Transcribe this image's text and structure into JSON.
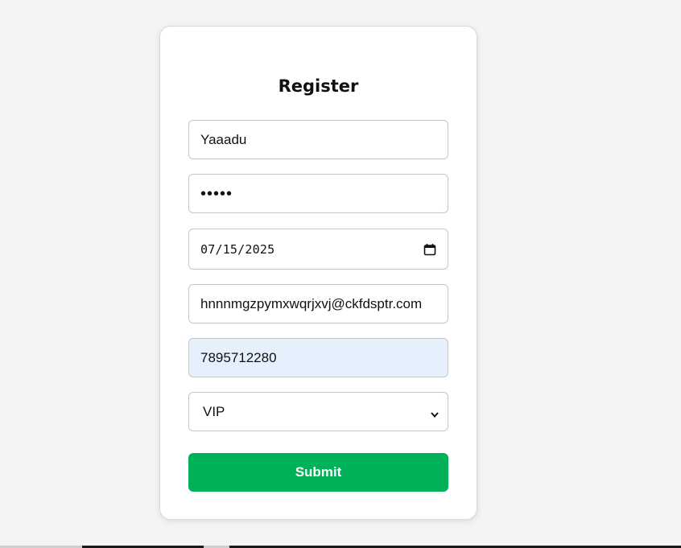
{
  "form": {
    "title": "Register",
    "username_value": "Yaaadu",
    "password_masked": "•••••",
    "date_value": "07/15/2025",
    "email_value": "hnnnmgzpymxwqrjxvj@ckfdsptr.com",
    "phone_value": "7895712280",
    "membership_selected": "VIP",
    "submit_label": "Submit"
  },
  "icons": {
    "date_picker": "calendar-icon",
    "select_arrow": "chevron-down-icon"
  },
  "colors": {
    "background": "#f4f4f4",
    "card": "#ffffff",
    "submit": "#00b159",
    "autofill": "#e6f0fd"
  }
}
